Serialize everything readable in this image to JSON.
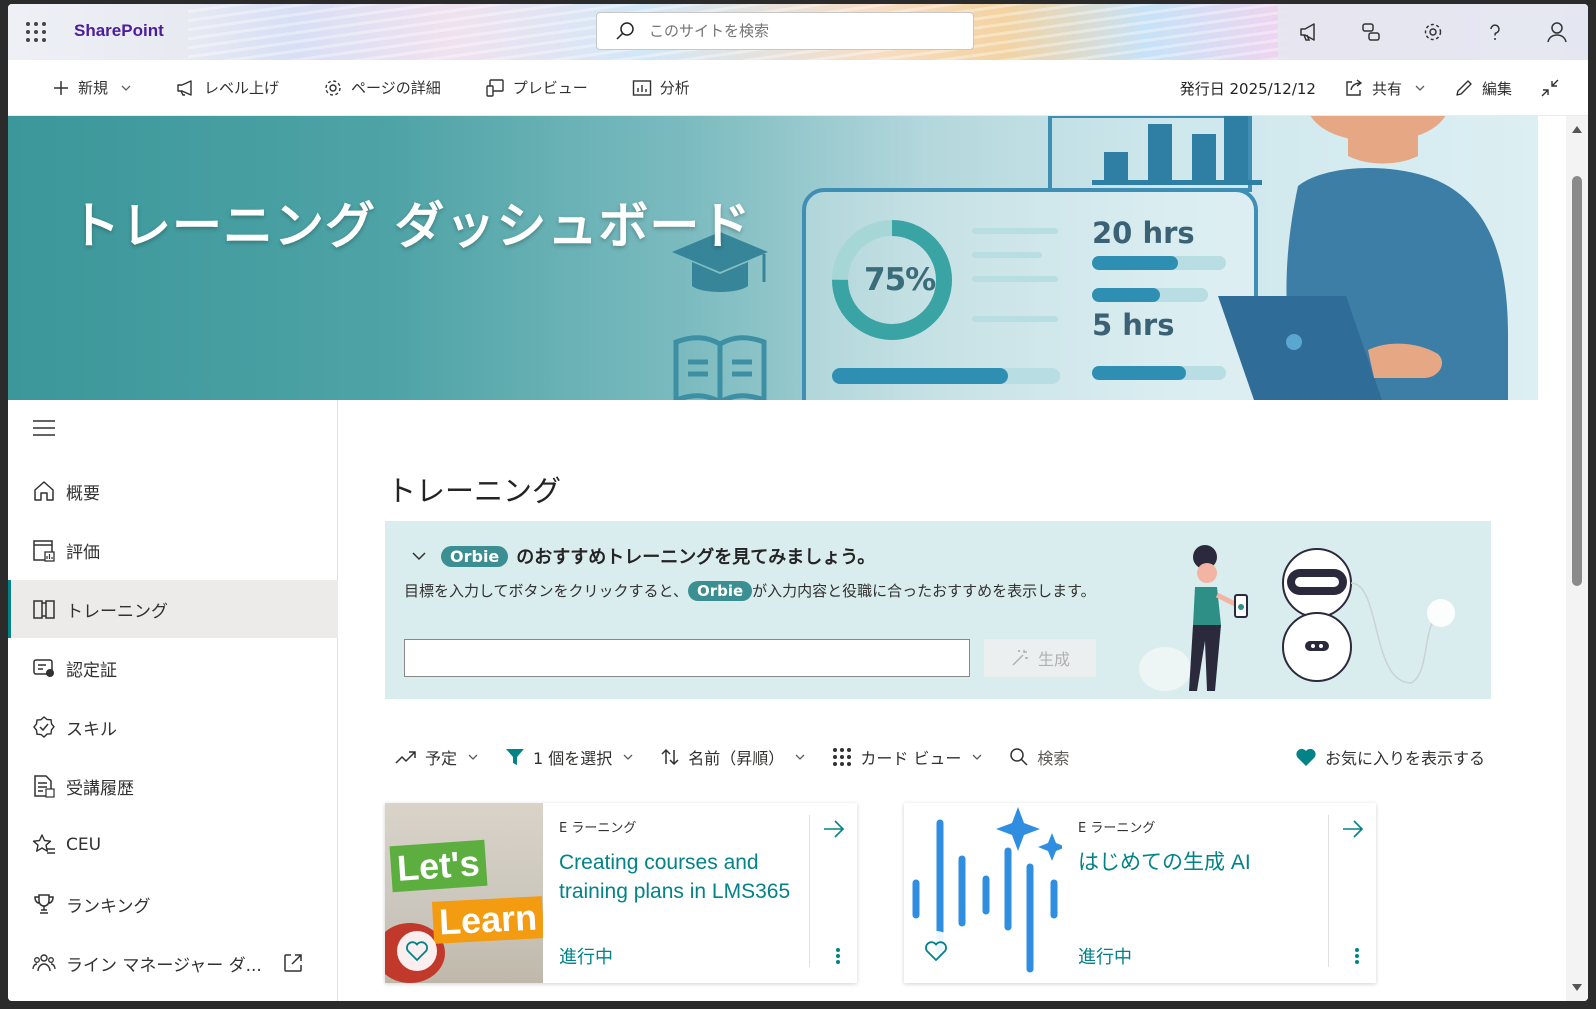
{
  "suite": {
    "brand": "SharePoint",
    "search_placeholder": "このサイトを検索"
  },
  "commands": {
    "new": "新規",
    "promote": "レベル上げ",
    "page_details": "ページの詳細",
    "preview": "プレビュー",
    "analytics": "分析",
    "published": "発行日 2025/12/12",
    "share": "共有",
    "edit": "編集"
  },
  "banner": {
    "title": "トレーニング ダッシュボード",
    "percent": "75%",
    "hours_1": "20 hrs",
    "hours_2": "5 hrs"
  },
  "nav": {
    "items": [
      {
        "label": "概要",
        "icon": "home-icon"
      },
      {
        "label": "評価",
        "icon": "assessment-icon"
      },
      {
        "label": "トレーニング",
        "icon": "book-icon",
        "active": true
      },
      {
        "label": "認定証",
        "icon": "certificate-icon"
      },
      {
        "label": "スキル",
        "icon": "skill-badge-icon"
      },
      {
        "label": "受講履歴",
        "icon": "history-icon"
      },
      {
        "label": "CEU",
        "icon": "star-list-icon"
      },
      {
        "label": "ランキング",
        "icon": "trophy-icon"
      },
      {
        "label": "ライン マネージャー ダ...",
        "icon": "people-icon"
      }
    ]
  },
  "main": {
    "title": "トレーニング",
    "orbie": {
      "name": "Orbie",
      "heading_rest": "のおすすめトレーニングを見てみましょう。",
      "desc_before": "目標を入力してボタンをクリックすると、",
      "desc_after": "が入力内容と役職に合ったおすすめを表示します。",
      "input_value": "",
      "generate": "生成"
    },
    "toolbar": {
      "scheduled": "予定",
      "filter": "1 個を選択",
      "sort": "名前（昇順）",
      "view": "カード ビュー",
      "search": "検索",
      "favorites": "お気に入りを表示する"
    },
    "cards": [
      {
        "kind": "E ラーニング",
        "title": "Creating courses and training plans in LMS365",
        "status": "進行中",
        "thumb_text_1": "Let's",
        "thumb_text_2": "Learn"
      },
      {
        "kind": "E ラーニング",
        "title": "はじめての生成 AI",
        "status": "進行中"
      }
    ]
  },
  "colors": {
    "accent": "#038387",
    "pill": "#3b8e91",
    "brand": "#4a1c9e"
  }
}
